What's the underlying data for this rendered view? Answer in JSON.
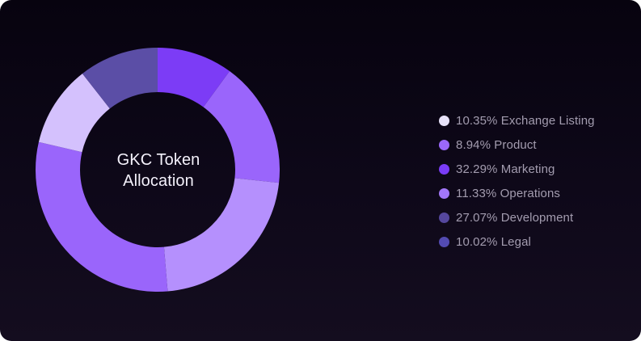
{
  "chart_data": {
    "type": "pie",
    "title": "GKC Token Allocation",
    "categories": [
      "Exchange Listing",
      "Product",
      "Marketing",
      "Operations",
      "Development",
      "Legal"
    ],
    "values": [
      10.35,
      8.94,
      32.29,
      11.33,
      27.07,
      10.02
    ],
    "colors": [
      "#e7e1f8",
      "#9b68fb",
      "#7a3cf6",
      "#a277f8",
      "#55479d",
      "#534bb2"
    ],
    "legend": [
      {
        "label": "10.35% Exchange Listing",
        "color": "#e7e1f8"
      },
      {
        "label": "8.94% Product",
        "color": "#9b68fb"
      },
      {
        "label": "32.29% Marketing",
        "color": "#7a3cf6"
      },
      {
        "label": "11.33% Operations",
        "color": "#a277f8"
      },
      {
        "label": "27.07% Development",
        "color": "#55479d"
      },
      {
        "label": "10.02% Legal",
        "color": "#534bb2"
      }
    ],
    "legend_position": "right",
    "grid": false,
    "donut": true,
    "donut_segments": [
      {
        "value": 10.04,
        "color": "#7c3cf6"
      },
      {
        "value": 16.68,
        "color": "#9a65fb"
      },
      {
        "value": 21.97,
        "color": "#b590fd"
      },
      {
        "value": 29.95,
        "color": "#9a65fb"
      },
      {
        "value": 10.79,
        "color": "#d4c1fd"
      },
      {
        "value": 10.57,
        "color": "#5b4ea6"
      }
    ]
  }
}
